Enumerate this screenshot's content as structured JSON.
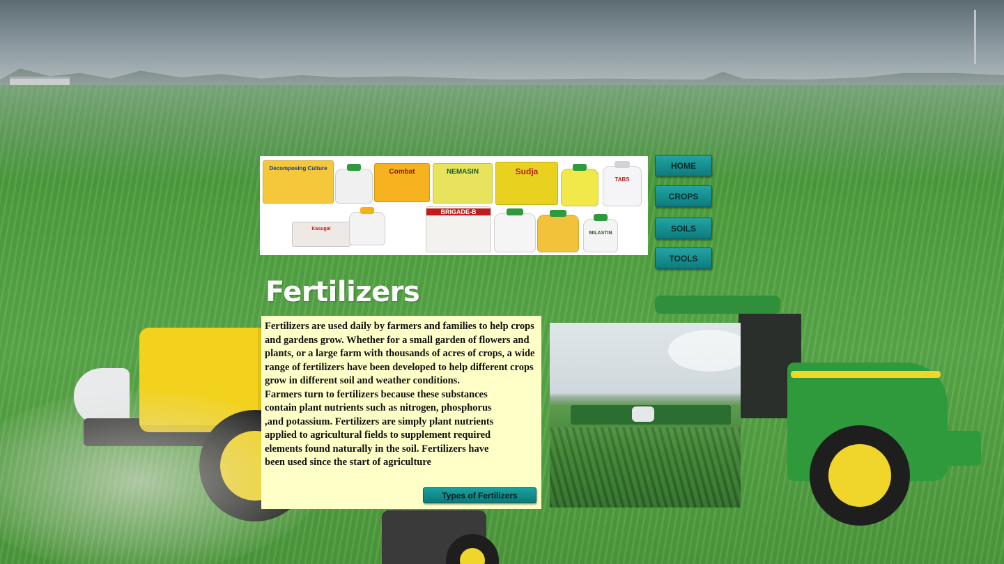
{
  "nav": {
    "home": "HOME",
    "crops": "CROPS",
    "soils": "SOILS",
    "tools": "TOOLS"
  },
  "banner": {
    "products": [
      "Decomposing Culture",
      "Combat",
      "NEMASIN",
      "Sudja",
      "TABS",
      "BRIGADE-B",
      "MILASTIN",
      "Kasugal"
    ]
  },
  "main": {
    "title": "Fertilizers",
    "paragraph1": "Fertilizers are used daily by farmers and families to help crops and gardens grow. Whether for a small garden of flowers and plants, or a large farm with thousands of acres of crops, a wide range of fertilizers have been developed to help different crops grow in different soil and weather conditions.",
    "paragraph2": "Farmers turn to fertilizers because these substances contain plant nutrients such as nitrogen, phosphorus ,and potassium. Fertilizers are simply plant nutrients applied to agricultural fields to supplement required elements found naturally in the soil. Fertilizers have been used since the start of agriculture",
    "types_button": "Types of Fertilizers"
  },
  "colors": {
    "panel_bg": "#ffffc8",
    "button_teal": "#0d7c7e",
    "title_text": "#ffffff"
  }
}
